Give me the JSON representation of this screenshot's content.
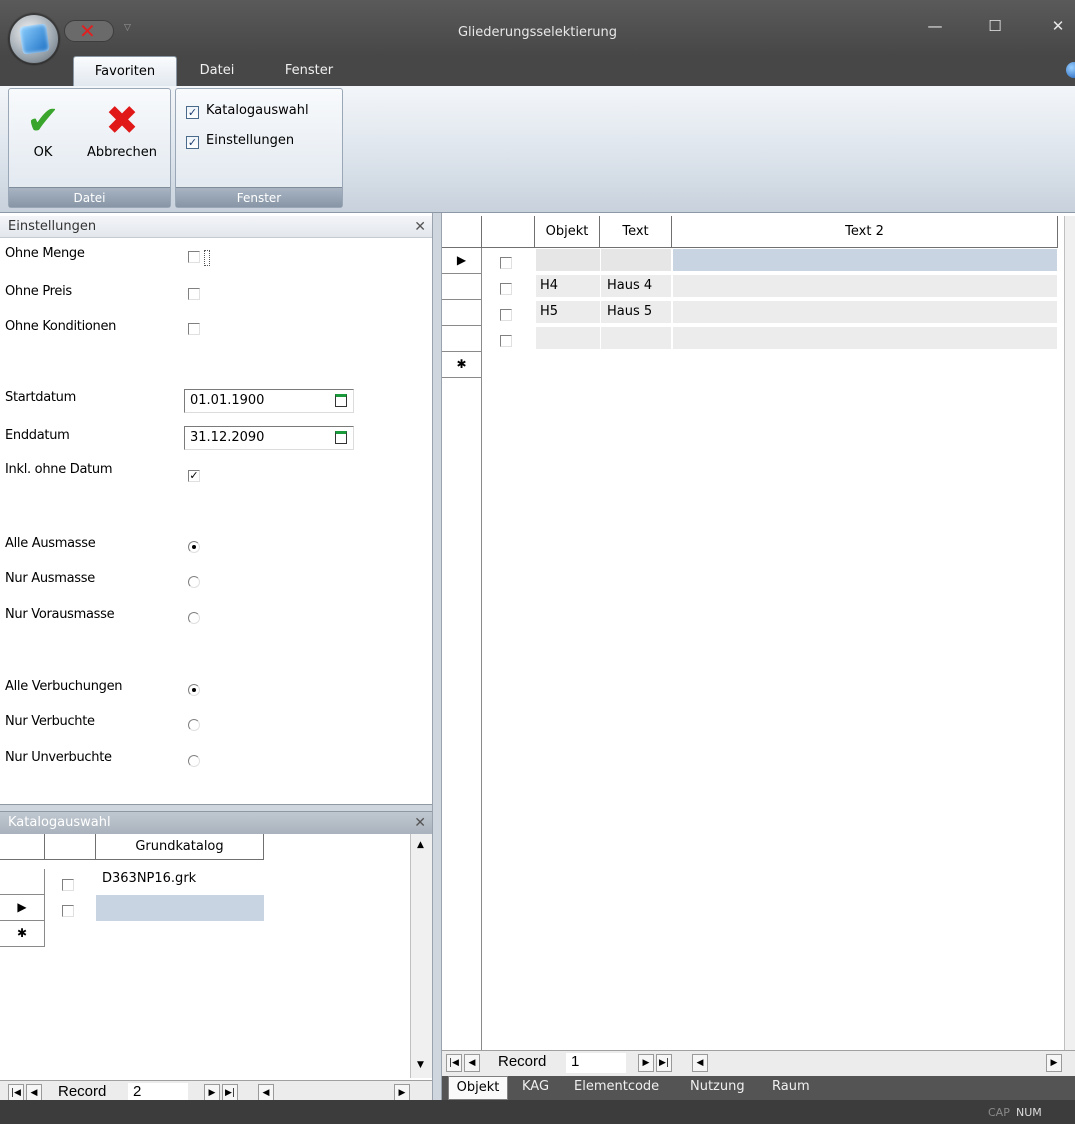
{
  "window": {
    "title": "Gliederungsselektierung",
    "min_label": "—",
    "max_label": "☐",
    "close_label": "✕"
  },
  "ribbon": {
    "tabs": [
      "Favoriten",
      "Datei",
      "Fenster"
    ],
    "ok_label": "OK",
    "cancel_label": "Abbrechen",
    "group_datei": "Datei",
    "group_fenster": "Fenster",
    "chk_katalog": "Katalogauswahl",
    "chk_einstellungen": "Einstellungen",
    "chk_katalog_checked": true,
    "chk_einstellungen_checked": true
  },
  "einstellungen": {
    "title": "Einstellungen",
    "ohne_menge": "Ohne Menge",
    "ohne_preis": "Ohne Preis",
    "ohne_konditionen": "Ohne Konditionen",
    "startdatum_label": "Startdatum",
    "startdatum": "01.01.1900",
    "enddatum_label": "Enddatum",
    "enddatum": "31.12.2090",
    "inkl_ohne_datum": "Inkl. ohne Datum",
    "inkl_ohne_datum_checked": true,
    "alle_ausmasse": "Alle Ausmasse",
    "nur_ausmasse": "Nur Ausmasse",
    "nur_vorausmasse": "Nur Vorausmasse",
    "ausmasse_selected": "Alle Ausmasse",
    "alle_verbuchungen": "Alle Verbuchungen",
    "nur_verbuchte": "Nur Verbuchte",
    "nur_unverbuchte": "Nur Unverbuchte",
    "verbuchungen_selected": "Alle Verbuchungen"
  },
  "katalog": {
    "title": "Katalogauswahl",
    "column": "Grundkatalog",
    "rows": [
      "D363NP16.grk",
      ""
    ],
    "record_label": "Record",
    "record_no": "2"
  },
  "main_grid": {
    "columns": [
      "Objekt",
      "Text",
      "Text 2"
    ],
    "rows": [
      {
        "objekt": "",
        "text": "",
        "text2": ""
      },
      {
        "objekt": "H4",
        "text": "Haus 4",
        "text2": ""
      },
      {
        "objekt": "H5",
        "text": "Haus 5",
        "text2": ""
      },
      {
        "objekt": "",
        "text": "",
        "text2": ""
      }
    ],
    "record_label": "Record",
    "record_no": "1"
  },
  "bottom_tabs": [
    "Objekt",
    "KAG",
    "Elementcode",
    "Nutzung",
    "Raum"
  ],
  "status": {
    "cap": "CAP",
    "num": "NUM"
  }
}
